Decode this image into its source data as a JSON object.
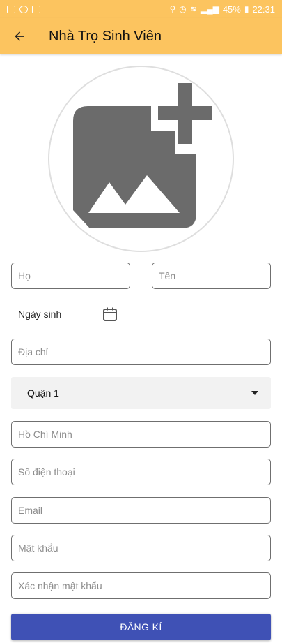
{
  "status_bar": {
    "battery": "45%",
    "time": "22:31"
  },
  "app_bar": {
    "title": "Nhà Trọ Sinh Viên"
  },
  "form": {
    "last_name_placeholder": "Họ",
    "first_name_placeholder": "Tên",
    "dob_label": "Ngày sinh",
    "address_placeholder": "Địa chỉ",
    "district_selected": "Quận 1",
    "city_placeholder": "Hồ Chí Minh",
    "phone_placeholder": "Số điện thoại",
    "email_placeholder": "Email",
    "password_placeholder": "Mật khẩu",
    "confirm_password_placeholder": "Xác nhận mật khẩu",
    "submit_label": "ĐĂNG KÍ"
  },
  "colors": {
    "app_bar": "#fcc45f",
    "button": "#3f51b5",
    "icon_gray": "#6b6b6b"
  },
  "icons": [
    "arrow-back-icon",
    "add-photo-icon",
    "calendar-icon",
    "dropdown-caret-icon"
  ]
}
